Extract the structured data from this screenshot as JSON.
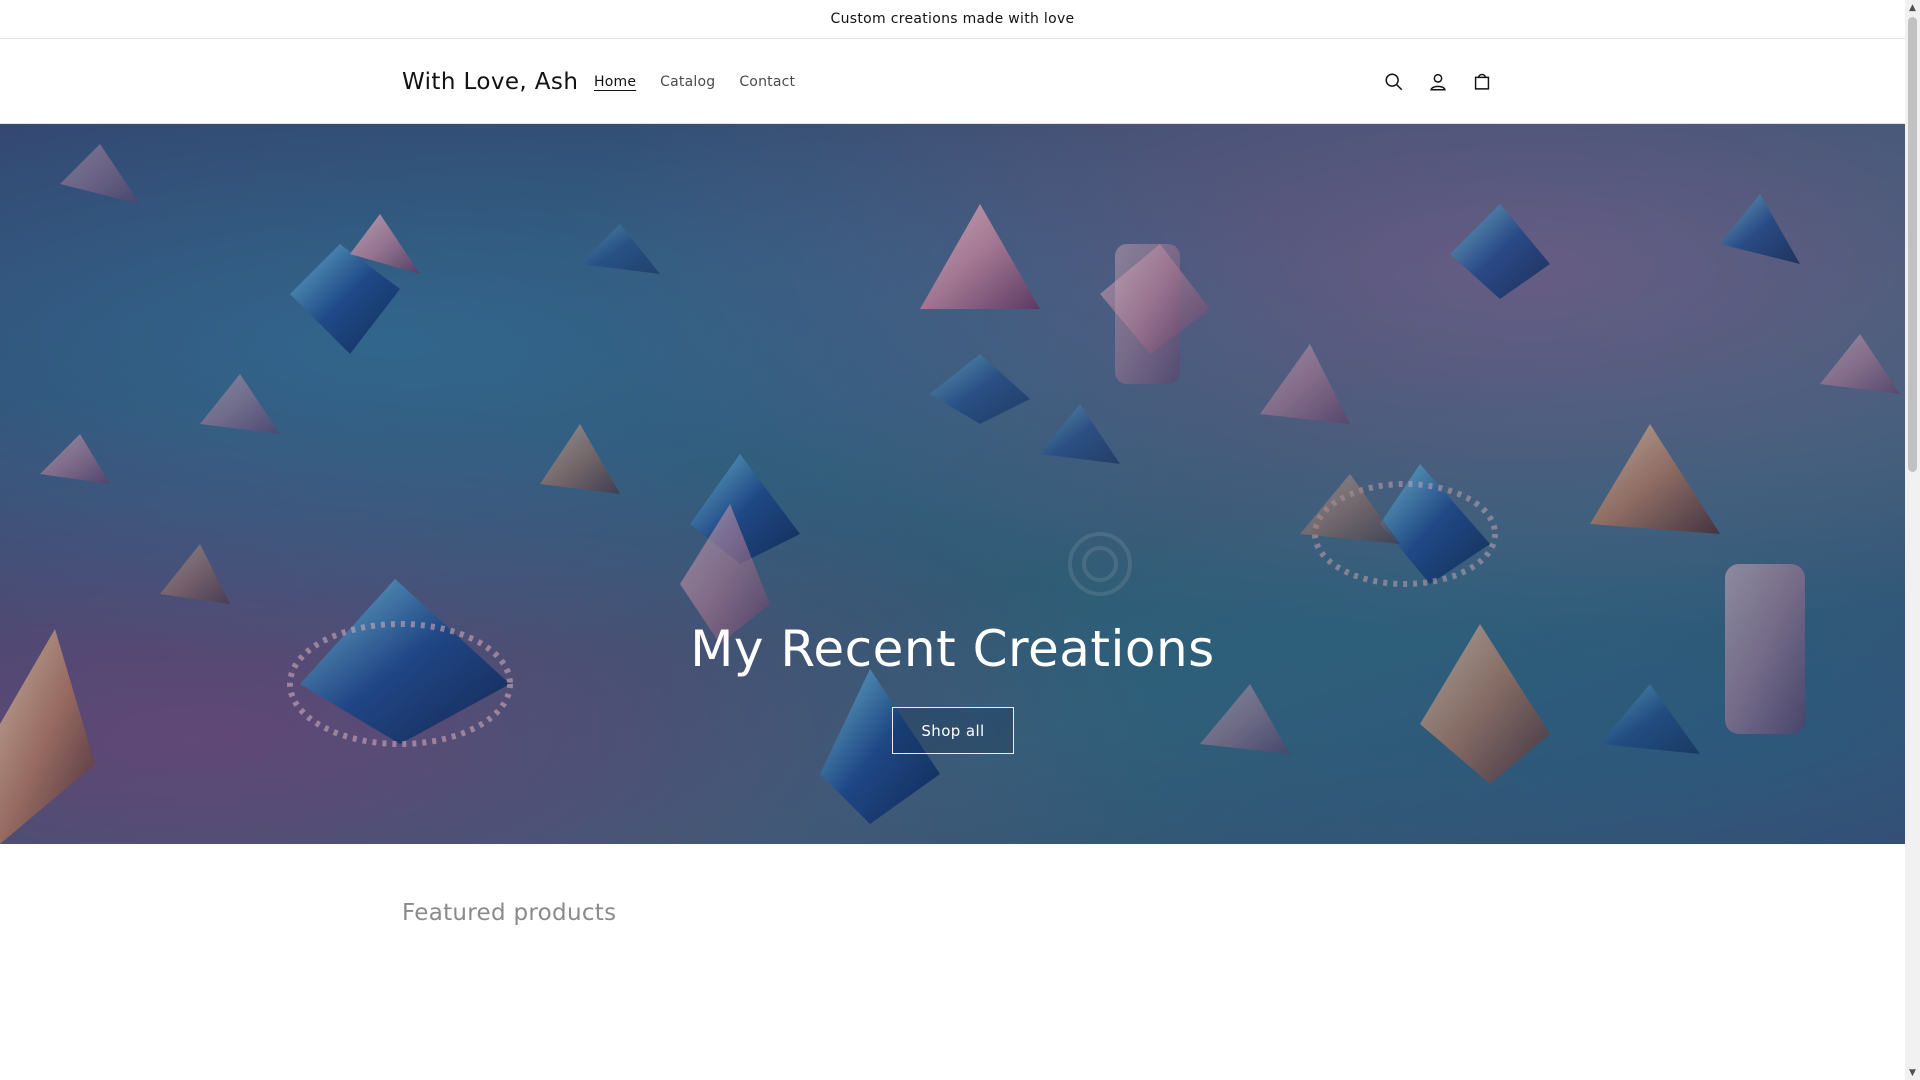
{
  "announcement": {
    "text": "Custom creations made with love"
  },
  "header": {
    "logo": "With Love, Ash",
    "nav": [
      {
        "label": "Home",
        "active": true
      },
      {
        "label": "Catalog",
        "active": false
      },
      {
        "label": "Contact",
        "active": false
      }
    ],
    "icons": [
      "search-icon",
      "account-icon",
      "cart-icon"
    ]
  },
  "hero": {
    "title": "My Recent Creations",
    "button_label": "Shop all"
  },
  "featured": {
    "title": "Featured products"
  },
  "colors": {
    "text": "#121212",
    "muted": "#8a8a8a",
    "border": "#e3e3e3",
    "hero_blue": "#35617f",
    "hero_purple": "#4a4d7a"
  }
}
